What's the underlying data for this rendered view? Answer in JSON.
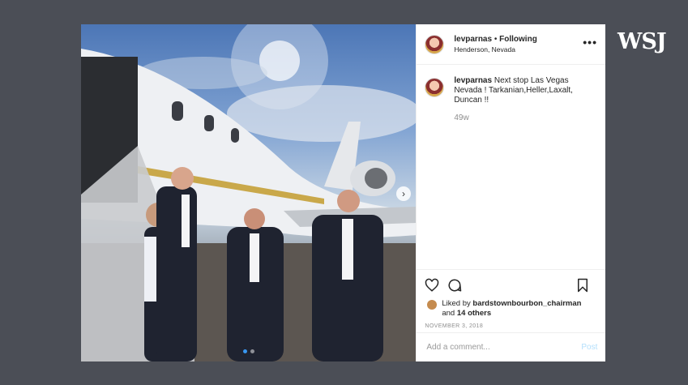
{
  "brand": {
    "logo_text": "WSJ"
  },
  "post": {
    "username": "levparnas",
    "separator": "•",
    "follow_status": "Following",
    "location": "Henderson, Nevada",
    "more_glyph": "•••",
    "caption_username": "levparnas",
    "caption_text": "Next stop Las Vegas Nevada ! Tarkanian,Heller,Laxalt, Duncan !!",
    "time_ago": "49w",
    "liked_by_prefix": "Liked by",
    "liked_by_user": "bardstownbourbon_chairman",
    "liked_by_and": "and",
    "others_count": "14 others",
    "date": "NOVEMBER 3, 2018",
    "comment_placeholder": "Add a comment...",
    "post_button": "Post",
    "carousel_next_glyph": "›",
    "carousel": {
      "count": 2,
      "active_index": 0
    }
  },
  "colors": {
    "background": "#4b4e56",
    "accent": "#3897f0",
    "post_button_disabled": "#b2dffc"
  },
  "icons": [
    "heart-icon",
    "comment-icon",
    "bookmark-icon",
    "more-options-icon",
    "chevron-right-icon"
  ]
}
